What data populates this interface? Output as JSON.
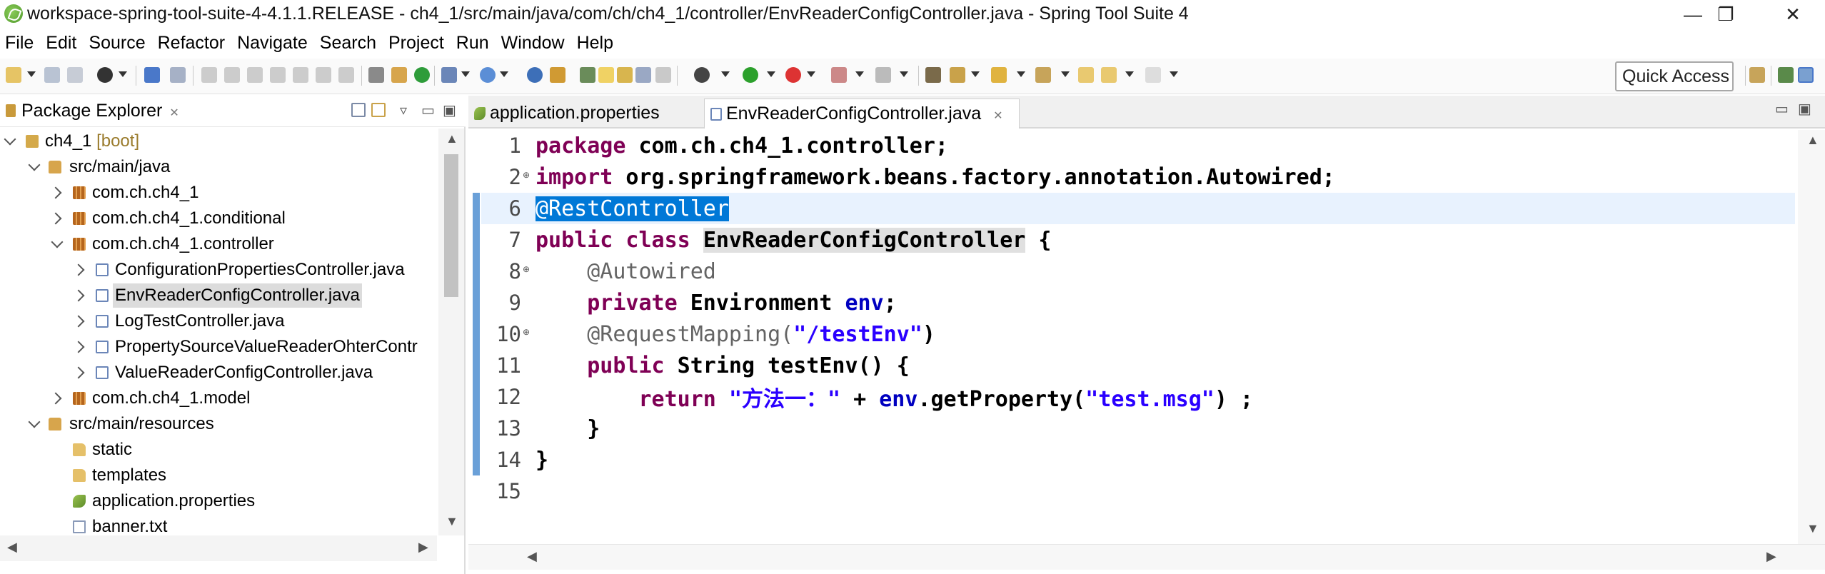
{
  "window": {
    "title": "workspace-spring-tool-suite-4-4.1.1.RELEASE - ch4_1/src/main/java/com/ch/ch4_1/controller/EnvReaderConfigController.java - Spring Tool Suite 4",
    "minimize": "—",
    "restore": "❐",
    "close": "✕"
  },
  "menu": [
    "File",
    "Edit",
    "Source",
    "Refactor",
    "Navigate",
    "Search",
    "Project",
    "Run",
    "Window",
    "Help"
  ],
  "toolbar": {
    "quick_access": "Quick Access"
  },
  "explorer": {
    "title": "Package Explorer",
    "close": "✕",
    "items": [
      {
        "label": "ch4_1",
        "suffix": "[boot]",
        "icon": "project-icon"
      },
      {
        "label": "src/main/java",
        "icon": "source-folder-icon"
      },
      {
        "label": "com.ch.ch4_1",
        "icon": "package-icon"
      },
      {
        "label": "com.ch.ch4_1.conditional",
        "icon": "package-icon"
      },
      {
        "label": "com.ch.ch4_1.controller",
        "icon": "package-icon"
      },
      {
        "label": "ConfigurationPropertiesController.java",
        "icon": "java-file-icon"
      },
      {
        "label": "EnvReaderConfigController.java",
        "icon": "java-file-icon"
      },
      {
        "label": "LogTestController.java",
        "icon": "java-file-icon"
      },
      {
        "label": "PropertySourceValueReaderOhterContr",
        "icon": "java-file-icon"
      },
      {
        "label": "ValueReaderConfigController.java",
        "icon": "java-file-icon"
      },
      {
        "label": "com.ch.ch4_1.model",
        "icon": "package-icon"
      },
      {
        "label": "src/main/resources",
        "icon": "source-folder-icon"
      },
      {
        "label": "static",
        "icon": "folder-icon"
      },
      {
        "label": "templates",
        "icon": "folder-icon"
      },
      {
        "label": "application.properties",
        "icon": "properties-file-icon"
      },
      {
        "label": "banner.txt",
        "icon": "text-file-icon"
      }
    ]
  },
  "editor": {
    "tabs": [
      {
        "label": "application.properties",
        "active": false
      },
      {
        "label": "EnvReaderConfigController.java",
        "active": true,
        "close": "✕"
      }
    ],
    "lines": [
      {
        "no": "1"
      },
      {
        "no": "2"
      },
      {
        "no": "6"
      },
      {
        "no": "7"
      },
      {
        "no": "8"
      },
      {
        "no": "9"
      },
      {
        "no": "10"
      },
      {
        "no": "11"
      },
      {
        "no": "12"
      },
      {
        "no": "13"
      },
      {
        "no": "14"
      },
      {
        "no": "15"
      }
    ],
    "code": {
      "l1_kw": "package",
      "l1_rest": " com.ch.ch4_1.controller;",
      "l2_kw": "import",
      "l2_rest": " org.springframework.beans.factory.annotation.Autowired;",
      "l6_ann": "@RestController",
      "l7_kw": "public class",
      "l7_name": "EnvReaderConfigController",
      "l7_rest": " {",
      "l8_ann": "@Autowired",
      "l9_kw": "private",
      "l9_type": " Environment ",
      "l9_fld": "env",
      "l9_end": ";",
      "l10_ann": "@RequestMapping(",
      "l10_str": "\"/testEnv\"",
      "l10_end": ")",
      "l11_kw": "public",
      "l11_rest": " String testEnv() {",
      "l12_kw": "return",
      "l12_str": "\"方法一：\"",
      "l12_mid": " + ",
      "l12_fld": "env",
      "l12_call": ".getProperty(",
      "l12_str2": "\"test.msg\"",
      "l12_end": ") ;",
      "l13": "}",
      "l14": "}"
    }
  }
}
